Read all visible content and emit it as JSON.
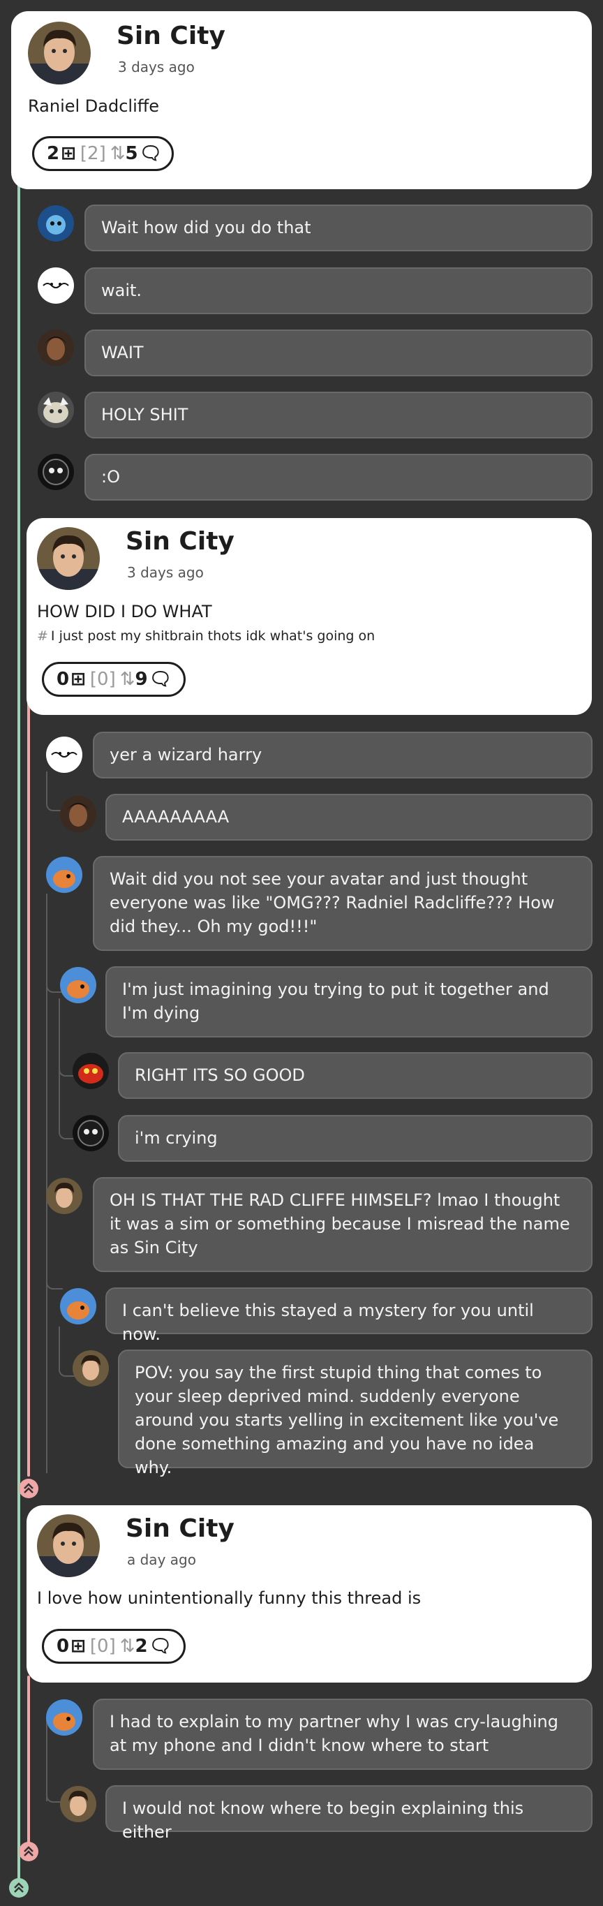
{
  "colors": {
    "background": "#323232",
    "card": "#ffffff",
    "bubble": "#575757",
    "thread_green": "#9ed3b7",
    "thread_pink": "#f0a7a7"
  },
  "post1": {
    "title": "Sin City",
    "time": "3 days ago",
    "body": "Raniel Dadcliffe",
    "stats": {
      "plus": "2",
      "reblogs": "[2]",
      "comments": "5"
    },
    "replies": [
      {
        "text": "Wait how did you do that"
      },
      {
        "text": "wait."
      },
      {
        "text": "WAIT"
      },
      {
        "text": "HOLY SHIT"
      },
      {
        "text": ":O"
      }
    ]
  },
  "post2": {
    "title": "Sin City",
    "time": "3 days ago",
    "body": "HOW DID I DO WHAT",
    "tag_hash": "#",
    "tag": "I just post my shitbrain thots idk what's going on",
    "stats": {
      "plus": "0",
      "reblogs": "[0]",
      "comments": "9"
    },
    "replies": [
      {
        "text": "yer a wizard harry"
      },
      {
        "text": "AAAAAAAAA"
      },
      {
        "text": "Wait did you not see your avatar and just thought everyone was like \"OMG??? Radniel Radcliffe??? How did they... Oh my god!!!\""
      },
      {
        "text": "I'm just imagining you trying to put it together and I'm dying"
      },
      {
        "text": "RIGHT ITS SO GOOD"
      },
      {
        "text": "i'm crying"
      },
      {
        "text": "OH IS THAT THE RAD CLIFFE HIMSELF? lmao I thought it was a sim or something because I misread the name as Sin City"
      },
      {
        "text": "I can't believe this stayed a mystery for you until now."
      },
      {
        "text": "POV: you say the first stupid thing that comes to your sleep deprived mind. suddenly everyone around you starts yelling in excitement like you've done something amazing and you have no idea why."
      }
    ]
  },
  "post3": {
    "title": "Sin City",
    "time": "a day ago",
    "body": "I love how unintentionally funny this thread is",
    "stats": {
      "plus": "0",
      "reblogs": "[0]",
      "comments": "2"
    },
    "replies": [
      {
        "text": "I had to explain to my partner why I was cry-laughing at my phone and I didn't know where to start"
      },
      {
        "text": "I would not know where to begin explaining this either"
      }
    ]
  },
  "icons": {
    "plus": "plus-square-icon",
    "reblog": "reblog-icon",
    "comment": "comment-bubble-icon",
    "collapse": "chevron-double-up-icon"
  }
}
